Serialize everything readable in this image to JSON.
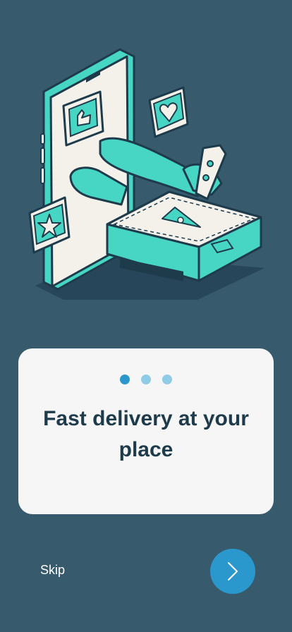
{
  "onboarding": {
    "illustration_icon": "phone-pizza-delivery-illustration",
    "pagination": {
      "total": 3,
      "active_index": 0
    },
    "headline": "Fast delivery at your place",
    "skip_label": "Skip",
    "next_icon": "chevron-right-icon"
  },
  "colors": {
    "background": "#375a6d",
    "card": "#f6f6f6",
    "accent": "#2a97cd",
    "dot_inactive": "#8fcbe4",
    "headline": "#1e3b4b",
    "illustration_teal": "#47d6c4"
  }
}
